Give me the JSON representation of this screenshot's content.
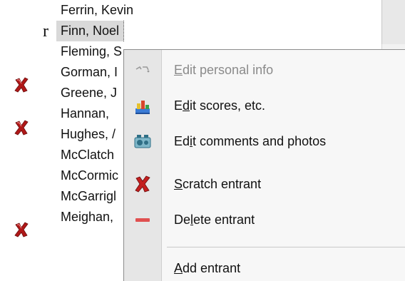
{
  "background_fragment": "r",
  "entrants": [
    {
      "name": "Ferrin, Kevin",
      "scratched": false,
      "selected": false
    },
    {
      "name": "Finn, Noel",
      "scratched": false,
      "selected": true
    },
    {
      "name": "Fleming, S",
      "scratched": false,
      "selected": false
    },
    {
      "name": "Gorman, I",
      "scratched": true,
      "selected": false
    },
    {
      "name": "Greene, J",
      "scratched": false,
      "selected": false
    },
    {
      "name": "Hannan, ",
      "scratched": true,
      "selected": false
    },
    {
      "name": "Hughes, /",
      "scratched": false,
      "selected": false
    },
    {
      "name": "McClatch",
      "scratched": false,
      "selected": false
    },
    {
      "name": "McCormic",
      "scratched": false,
      "selected": false
    },
    {
      "name": "McGarrigl",
      "scratched": false,
      "selected": false
    },
    {
      "name": "Meighan,",
      "scratched": true,
      "selected": false
    }
  ],
  "context_menu": {
    "items": [
      {
        "pre": "",
        "key": "E",
        "post": "dit personal info",
        "icon": "personal-info-icon",
        "disabled": true
      },
      {
        "pre": "E",
        "key": "d",
        "post": "it scores, etc.",
        "icon": "scores-chart-icon",
        "disabled": false
      },
      {
        "pre": "Ed",
        "key": "i",
        "post": "t comments and photos",
        "icon": "comments-photos-icon",
        "disabled": false
      },
      {
        "pre": "",
        "key": "S",
        "post": "cratch entrant",
        "icon": "scratch-x-icon",
        "disabled": false
      },
      {
        "pre": "De",
        "key": "l",
        "post": "ete entrant",
        "icon": "delete-minus-icon",
        "disabled": false
      },
      {
        "pre": "",
        "key": "A",
        "post": "dd entrant",
        "icon": "add-entrant-icon",
        "disabled": false
      }
    ]
  },
  "colors": {
    "scratch_red": "#b01818",
    "selection_bg": "#d9d9d9",
    "menu_bg": "#f7f7f7",
    "menu_rail": "#e6e6e6",
    "disabled_text": "#8a8a8a",
    "delete_red": "#e05050"
  }
}
